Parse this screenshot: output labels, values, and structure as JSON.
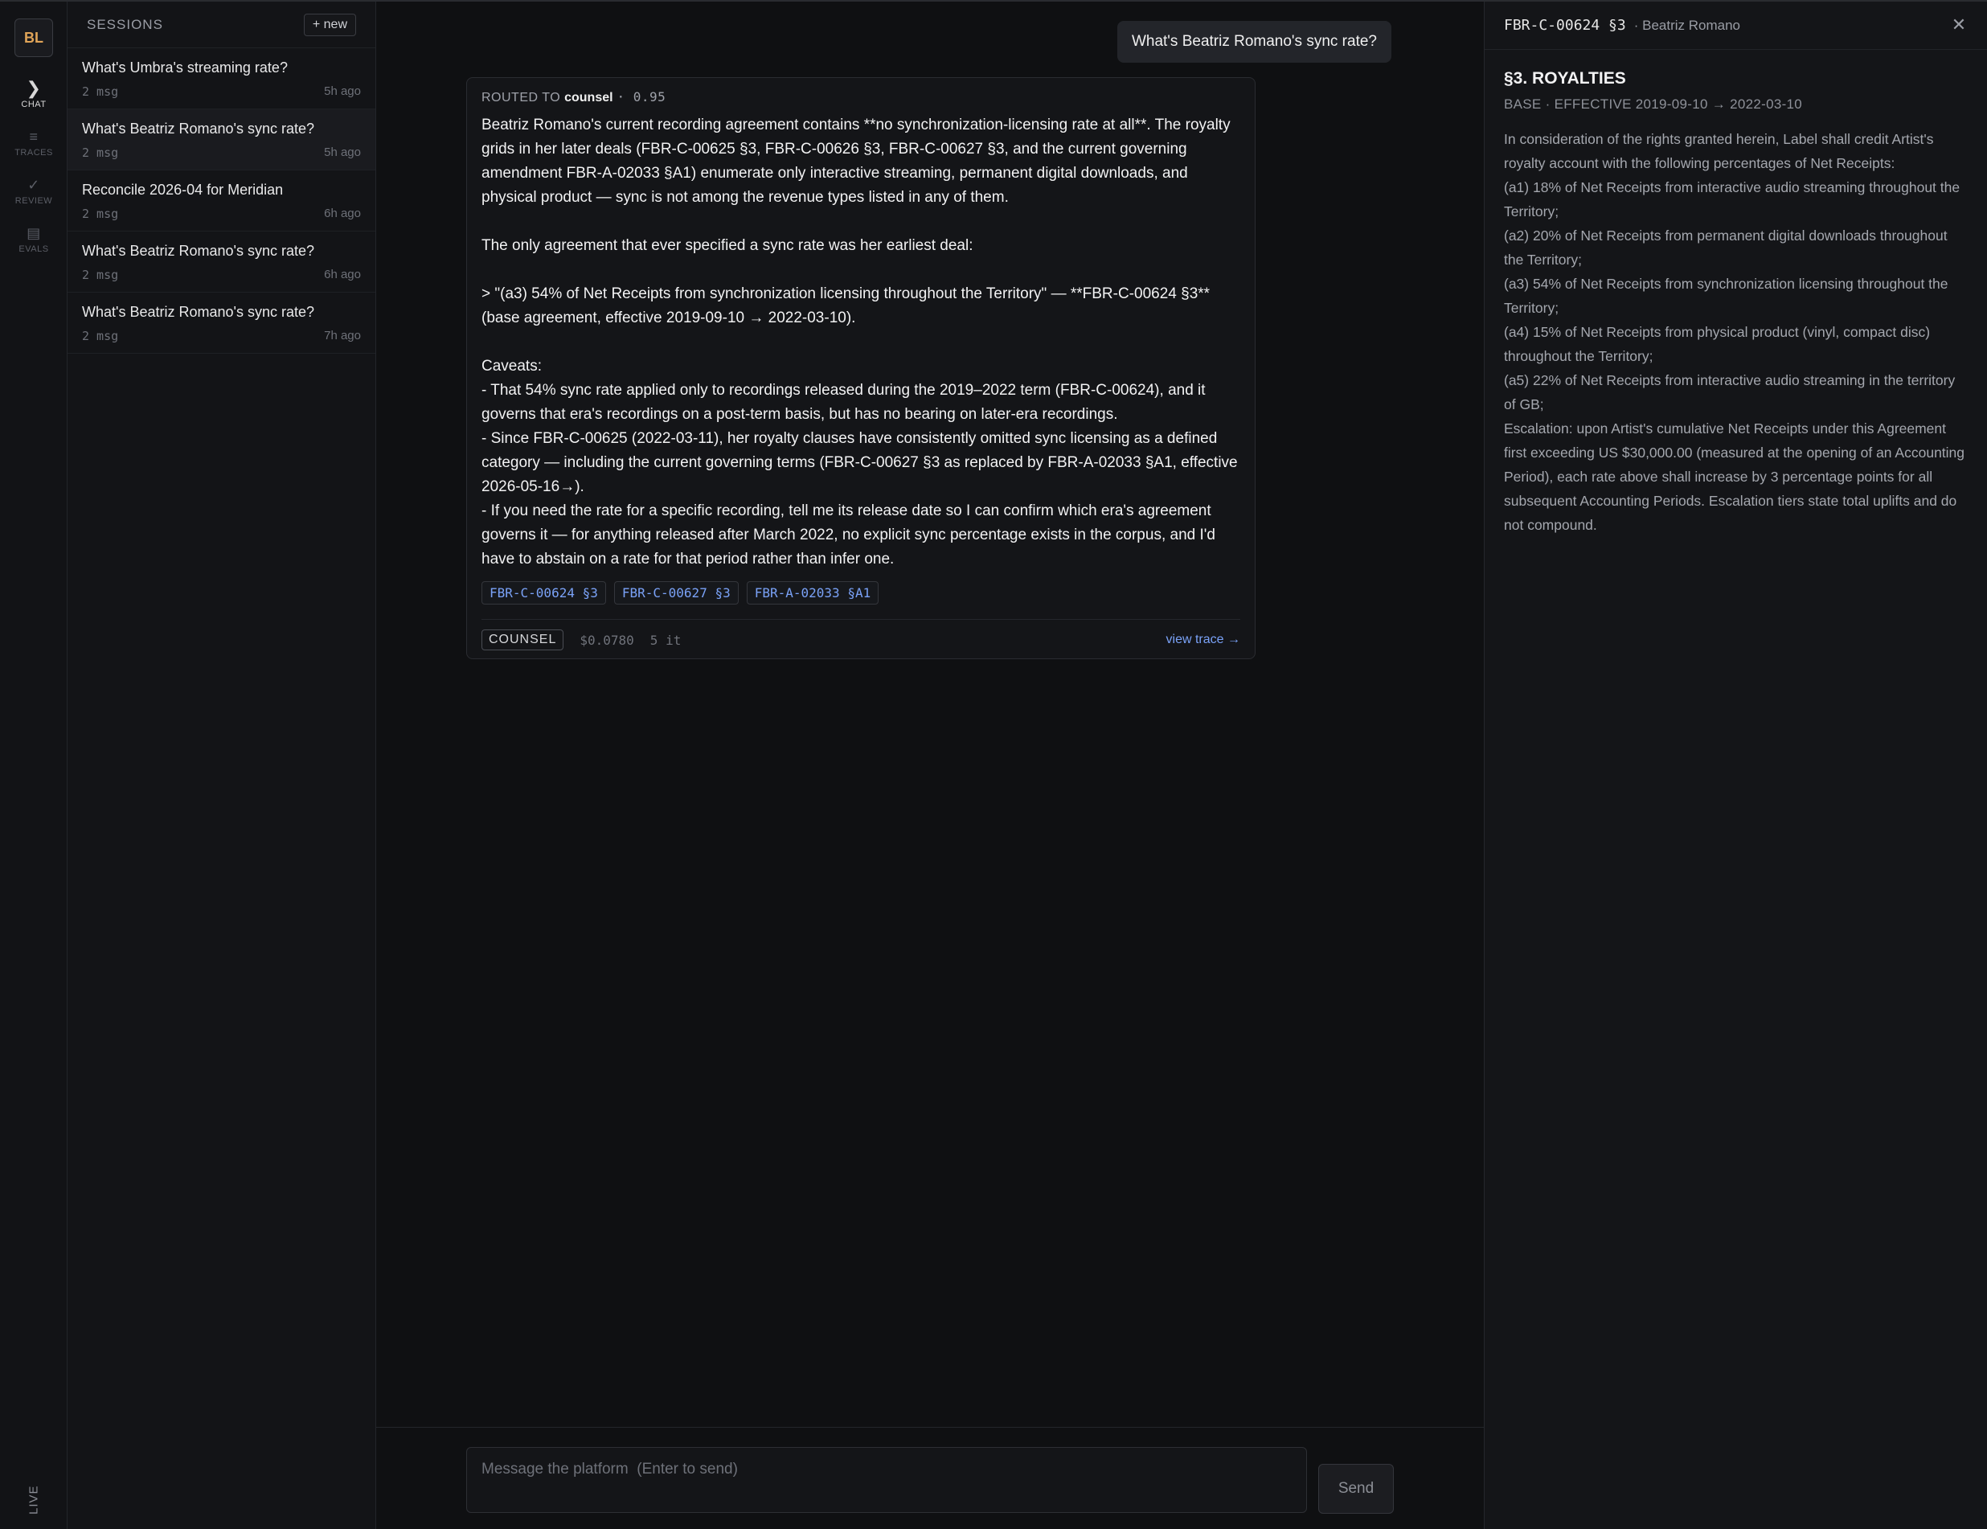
{
  "rail": {
    "avatar": "BL",
    "items": [
      {
        "label": "CHAT",
        "icon": "chevron-right-icon",
        "glyph": "❯"
      },
      {
        "label": "TRACES",
        "icon": "list-icon",
        "glyph": "≡"
      },
      {
        "label": "REVIEW",
        "icon": "check-icon",
        "glyph": "✓"
      },
      {
        "label": "EVALS",
        "icon": "table-icon",
        "glyph": "▤"
      }
    ],
    "status": "LIVE"
  },
  "sessions": {
    "title": "SESSIONS",
    "new_label": "+ new",
    "items": [
      {
        "title": "What's Umbra's streaming rate?",
        "count": "2 msg",
        "time": "5h ago"
      },
      {
        "title": "What's Beatriz Romano's sync rate?",
        "count": "2 msg",
        "time": "5h ago"
      },
      {
        "title": "Reconcile 2026-04 for Meridian",
        "count": "2 msg",
        "time": "6h ago"
      },
      {
        "title": "What's Beatriz Romano's sync rate?",
        "count": "2 msg",
        "time": "6h ago"
      },
      {
        "title": "What's Beatriz Romano's sync rate?",
        "count": "2 msg",
        "time": "7h ago"
      }
    ]
  },
  "chat": {
    "user_message": "What's Beatriz Romano's sync rate?",
    "answer": {
      "routed_label": "ROUTED TO",
      "routed_agent": "counsel",
      "routed_score": "· 0.95",
      "body": "Beatriz Romano's current recording agreement contains **no synchronization-licensing rate at all**. The royalty grids in her later deals (FBR-C-00625 §3, FBR-C-00626 §3, FBR-C-00627 §3, and the current governing amendment FBR-A-02033 §A1) enumerate only interactive streaming, permanent digital downloads, and physical product — sync is not among the revenue types listed in any of them.\n\nThe only agreement that ever specified a sync rate was her earliest deal:\n\n> \"(a3) 54% of Net Receipts from synchronization licensing throughout the Territory\" — **FBR-C-00624 §3** (base agreement, effective 2019-09-10 → 2022-03-10).\n\nCaveats:\n- That 54% sync rate applied only to recordings released during the 2019–2022 term (FBR-C-00624), and it governs that era's recordings on a post-term basis, but has no bearing on later-era recordings.\n- Since FBR-C-00625 (2022-03-11), her royalty clauses have consistently omitted sync licensing as a defined category — including the current governing terms (FBR-C-00627 §3 as replaced by FBR-A-02033 §A1, effective 2026-05-16→).\n- If you need the rate for a specific recording, tell me its release date so I can confirm which era's agreement governs it — for anything released after March 2022, no explicit sync percentage exists in the corpus, and I'd have to abstain on a rate for that period rather than infer one.",
      "citations": [
        "FBR-C-00624 §3",
        "FBR-C-00627 §3",
        "FBR-A-02033 §A1"
      ],
      "badge": "COUNSEL",
      "cost": "$0.0780",
      "iterations": "5 it",
      "trace_link": "view trace →"
    },
    "composer_placeholder": "Message the platform  (Enter to send)",
    "send_label": "Send"
  },
  "doc": {
    "id": "FBR-C-00624 §3",
    "who": "· Beatriz Romano",
    "title": "§3. ROYALTIES",
    "subtitle": "BASE · EFFECTIVE 2019-09-10 → 2022-03-10",
    "paragraphs": [
      "In consideration of the rights granted herein, Label shall credit Artist's royalty account with the following percentages of Net Receipts:",
      "(a1) 18% of Net Receipts from interactive audio streaming throughout the Territory;",
      "(a2) 20% of Net Receipts from permanent digital downloads throughout the Territory;",
      "(a3) 54% of Net Receipts from synchronization licensing throughout the Territory;",
      "(a4) 15% of Net Receipts from physical product (vinyl, compact disc) throughout the Territory;",
      "(a5) 22% of Net Receipts from interactive audio streaming in the territory of GB;",
      "Escalation: upon Artist's cumulative Net Receipts under this Agreement first exceeding US $30,000.00 (measured at the opening of an Accounting Period), each rate above shall increase by 3 percentage points for all subsequent Accounting Periods. Escalation tiers state total uplifts and do not compound."
    ]
  }
}
